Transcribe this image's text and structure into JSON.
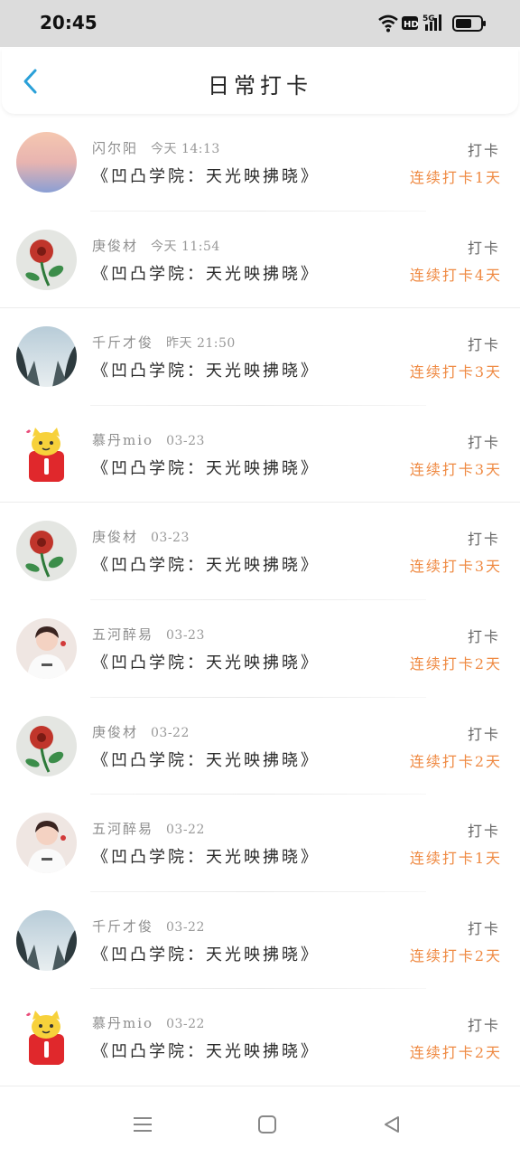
{
  "status_bar": {
    "time": "20:45",
    "icons": [
      "wifi-icon",
      "hd-icon",
      "5g-signal-icon",
      "battery-icon"
    ],
    "hd_label": "HD",
    "network_label": "5G"
  },
  "header": {
    "title": "日常打卡",
    "back_icon": "chevron-left-icon",
    "accent_color": "#2aa0d8"
  },
  "items": [
    {
      "name": "闪尔阳",
      "time": "今天 14:13",
      "course": "《凹凸学院：天光映拂晓》",
      "action": "打卡",
      "streak": "连续打卡1天",
      "avatar": "gradient-sunset"
    },
    {
      "name": "庚俊材",
      "time": "今天 11:54",
      "course": "《凹凸学院：天光映拂晓》",
      "action": "打卡",
      "streak": "连续打卡4天",
      "avatar": "red-flower"
    },
    {
      "name": "千斤才俊",
      "time": "昨天 21:50",
      "course": "《凹凸学院：天光映拂晓》",
      "action": "打卡",
      "streak": "连续打卡3天",
      "avatar": "forest"
    },
    {
      "name": "慕丹mio",
      "time": "03-23",
      "course": "《凹凸学院：天光映拂晓》",
      "action": "打卡",
      "streak": "连续打卡3天",
      "avatar": "yellow-cat"
    },
    {
      "name": "庚俊材",
      "time": "03-23",
      "course": "《凹凸学院：天光映拂晓》",
      "action": "打卡",
      "streak": "连续打卡3天",
      "avatar": "red-flower"
    },
    {
      "name": "五河醉易",
      "time": "03-23",
      "course": "《凹凸学院：天光映拂晓》",
      "action": "打卡",
      "streak": "连续打卡2天",
      "avatar": "person"
    },
    {
      "name": "庚俊材",
      "time": "03-22",
      "course": "《凹凸学院：天光映拂晓》",
      "action": "打卡",
      "streak": "连续打卡2天",
      "avatar": "red-flower"
    },
    {
      "name": "五河醉易",
      "time": "03-22",
      "course": "《凹凸学院：天光映拂晓》",
      "action": "打卡",
      "streak": "连续打卡1天",
      "avatar": "person"
    },
    {
      "name": "千斤才俊",
      "time": "03-22",
      "course": "《凹凸学院：天光映拂晓》",
      "action": "打卡",
      "streak": "连续打卡2天",
      "avatar": "forest"
    },
    {
      "name": "慕丹mio",
      "time": "03-22",
      "course": "《凹凸学院：天光映拂晓》",
      "action": "打卡",
      "streak": "连续打卡2天",
      "avatar": "yellow-cat"
    }
  ],
  "bottom_nav": {
    "icons": [
      "menu-icon",
      "home-square-icon",
      "back-triangle-icon"
    ]
  },
  "colors": {
    "streak": "#ef8a43",
    "status_bar_bg": "#dcdcdc",
    "back_arrow": "#2aa0d8"
  }
}
